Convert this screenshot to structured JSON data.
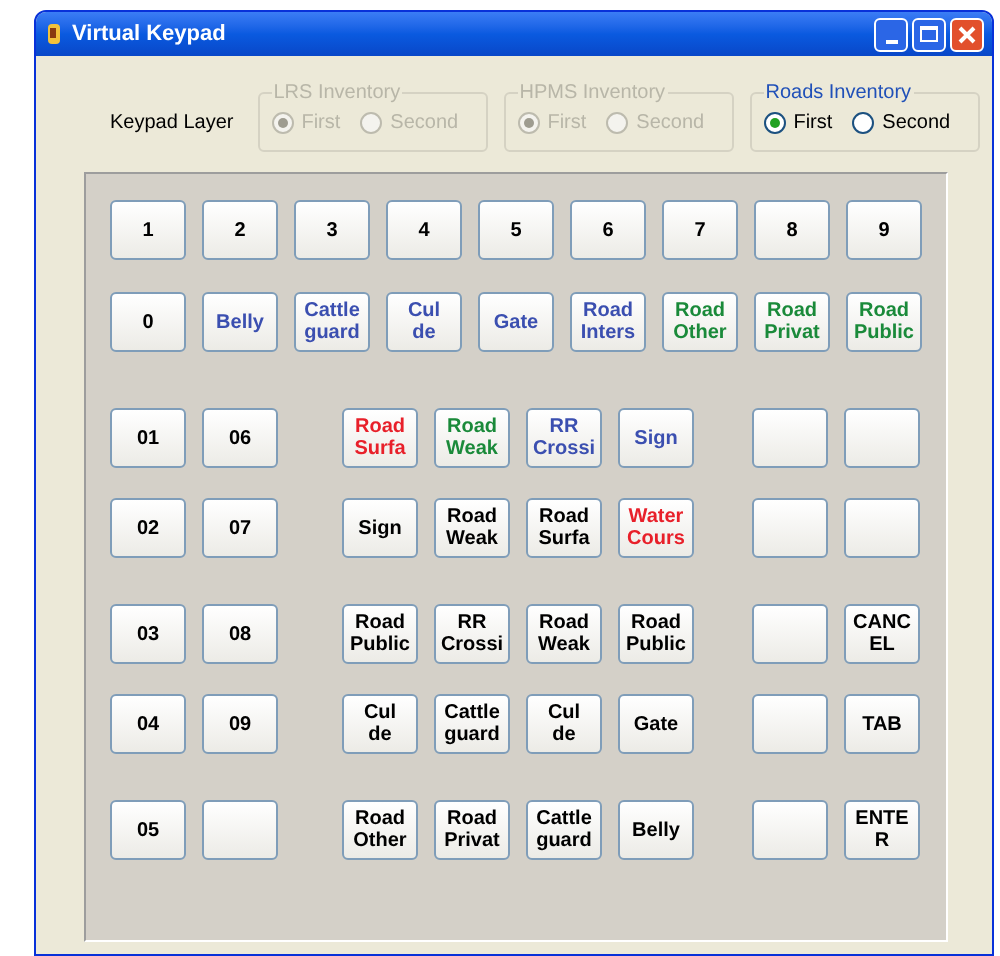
{
  "window": {
    "title": "Virtual Keypad"
  },
  "keypad_layer": {
    "label": "Keypad Layer",
    "groups": [
      {
        "title": "LRS Inventory",
        "disabled": true,
        "options": [
          {
            "label": "First",
            "selected": true
          },
          {
            "label": "Second",
            "selected": false
          }
        ]
      },
      {
        "title": "HPMS Inventory",
        "disabled": true,
        "options": [
          {
            "label": "First",
            "selected": true
          },
          {
            "label": "Second",
            "selected": false
          }
        ]
      },
      {
        "title": "Roads Inventory",
        "disabled": false,
        "options": [
          {
            "label": "First",
            "selected": true
          },
          {
            "label": "Second",
            "selected": false
          }
        ]
      }
    ]
  },
  "top_rows": [
    [
      {
        "kind": "key",
        "label": "1",
        "color": "#000000"
      },
      {
        "kind": "key",
        "label": "2",
        "color": "#000000"
      },
      {
        "kind": "key",
        "label": "3",
        "color": "#000000"
      },
      {
        "kind": "key",
        "label": "4",
        "color": "#000000"
      },
      {
        "kind": "key",
        "label": "5",
        "color": "#000000"
      },
      {
        "kind": "key",
        "label": "6",
        "color": "#000000"
      },
      {
        "kind": "key",
        "label": "7",
        "color": "#000000"
      },
      {
        "kind": "key",
        "label": "8",
        "color": "#000000"
      },
      {
        "kind": "key",
        "label": "9",
        "color": "#000000"
      }
    ],
    [
      {
        "kind": "key",
        "label": "0",
        "color": "#000000"
      },
      {
        "kind": "key",
        "label": "Belly",
        "color": "#3b4fb0"
      },
      {
        "kind": "key",
        "label": "Cattle guard",
        "color": "#3b4fb0"
      },
      {
        "kind": "key",
        "label": "Cul de",
        "color": "#3b4fb0"
      },
      {
        "kind": "key",
        "label": "Gate",
        "color": "#3b4fb0"
      },
      {
        "kind": "key",
        "label": "Road Inters",
        "color": "#3b4fb0"
      },
      {
        "kind": "key",
        "label": "Road Other",
        "color": "#1a8a3a"
      },
      {
        "kind": "key",
        "label": "Road Privat",
        "color": "#1a8a3a"
      },
      {
        "kind": "key",
        "label": "Road Public",
        "color": "#1a8a3a"
      }
    ]
  ],
  "lower_rows": [
    {
      "left": [
        {
          "kind": "key",
          "label": "01",
          "color": "#000000"
        },
        {
          "kind": "key",
          "label": "06",
          "color": "#000000"
        }
      ],
      "middle": [
        {
          "kind": "key",
          "label": "Road Surfa",
          "color": "#e8202a"
        },
        {
          "kind": "key",
          "label": "Road Weak",
          "color": "#1a8a3a"
        },
        {
          "kind": "key",
          "label": "RR Crossi",
          "color": "#3b4fb0"
        },
        {
          "kind": "key",
          "label": "Sign",
          "color": "#3b4fb0"
        }
      ],
      "right": [
        {
          "kind": "blank"
        },
        {
          "kind": "blank"
        }
      ]
    },
    {
      "left": [
        {
          "kind": "key",
          "label": "02",
          "color": "#000000"
        },
        {
          "kind": "key",
          "label": "07",
          "color": "#000000"
        }
      ],
      "middle": [
        {
          "kind": "key",
          "label": "Sign",
          "color": "#000000"
        },
        {
          "kind": "key",
          "label": "Road Weak",
          "color": "#000000"
        },
        {
          "kind": "key",
          "label": "Road Surfa",
          "color": "#000000"
        },
        {
          "kind": "key",
          "label": "Water Cours",
          "color": "#e8202a"
        }
      ],
      "right": [
        {
          "kind": "blank"
        },
        {
          "kind": "blank"
        }
      ]
    },
    {
      "left": [
        {
          "kind": "key",
          "label": "03",
          "color": "#000000"
        },
        {
          "kind": "key",
          "label": "08",
          "color": "#000000"
        }
      ],
      "middle": [
        {
          "kind": "key",
          "label": "Road Public",
          "color": "#000000"
        },
        {
          "kind": "key",
          "label": "RR Crossi",
          "color": "#000000"
        },
        {
          "kind": "key",
          "label": "Road Weak",
          "color": "#000000"
        },
        {
          "kind": "key",
          "label": "Road Public",
          "color": "#000000"
        }
      ],
      "right": [
        {
          "kind": "blank"
        },
        {
          "kind": "key",
          "label": "CANC EL",
          "color": "#000000"
        }
      ]
    },
    {
      "left": [
        {
          "kind": "key",
          "label": "04",
          "color": "#000000"
        },
        {
          "kind": "key",
          "label": "09",
          "color": "#000000"
        }
      ],
      "middle": [
        {
          "kind": "key",
          "label": "Cul de",
          "color": "#000000"
        },
        {
          "kind": "key",
          "label": "Cattle guard",
          "color": "#000000"
        },
        {
          "kind": "key",
          "label": "Cul de",
          "color": "#000000"
        },
        {
          "kind": "key",
          "label": "Gate",
          "color": "#000000"
        }
      ],
      "right": [
        {
          "kind": "blank"
        },
        {
          "kind": "key",
          "label": "TAB",
          "color": "#000000"
        }
      ]
    },
    {
      "left": [
        {
          "kind": "key",
          "label": "05",
          "color": "#000000"
        },
        {
          "kind": "blank"
        }
      ],
      "middle": [
        {
          "kind": "key",
          "label": "Road Other",
          "color": "#000000"
        },
        {
          "kind": "key",
          "label": "Road Privat",
          "color": "#000000"
        },
        {
          "kind": "key",
          "label": "Cattle guard",
          "color": "#000000"
        },
        {
          "kind": "key",
          "label": "Belly",
          "color": "#000000"
        }
      ],
      "right": [
        {
          "kind": "blank"
        },
        {
          "kind": "key",
          "label": "ENTE R",
          "color": "#000000"
        }
      ]
    }
  ]
}
